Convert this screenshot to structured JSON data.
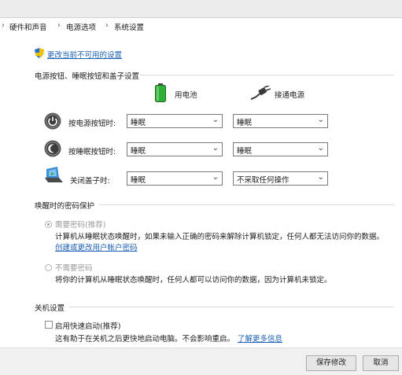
{
  "breadcrumb": {
    "items": [
      "硬件和声音",
      "电源选项",
      "系统设置"
    ],
    "sep_icon": "chevron-right-icon"
  },
  "change_settings_link": "更改当前不可用的设置",
  "power_section": {
    "title": "电源按钮、睡眠按钮和盖子设置",
    "battery_label": "用电池",
    "plugged_label": "接通电源",
    "rows": [
      {
        "label": "按电源按钮时:",
        "battery": "睡眠",
        "plugged": "睡眠",
        "icon": "power-button-icon"
      },
      {
        "label": "按睡眠按钮时:",
        "battery": "睡眠",
        "plugged": "睡眠",
        "icon": "sleep-button-icon"
      },
      {
        "label": "关闭盖子时:",
        "battery": "睡眠",
        "plugged": "不采取任何操作",
        "icon": "laptop-lid-icon"
      }
    ]
  },
  "wake_section": {
    "title": "唤醒时的密码保护",
    "require_label": "需要密码(推荐)",
    "require_desc": "计算机从睡眠状态唤醒时，如果未输入正确的密码来解除计算机锁定，任何人都无法访问你的数据。",
    "create_link": "创建或更改用户帐户密码",
    "no_require_label": "不需要密码",
    "no_require_desc": "将你的计算机从睡眠状态唤醒时，任何人都可以访问你的数据，因为计算机未锁定。"
  },
  "shutdown_section": {
    "title": "关机设置",
    "fast_startup_label": "启用快速启动(推荐)",
    "fast_startup_desc": "这有助于在关机之后更快地启动电脑。不会影响重启。",
    "learn_more": "了解更多信息"
  },
  "buttons": {
    "save": "保存修改",
    "cancel": "取消"
  },
  "colors": {
    "link": "#1a5fb4",
    "disabled": "#9a9a9a"
  }
}
